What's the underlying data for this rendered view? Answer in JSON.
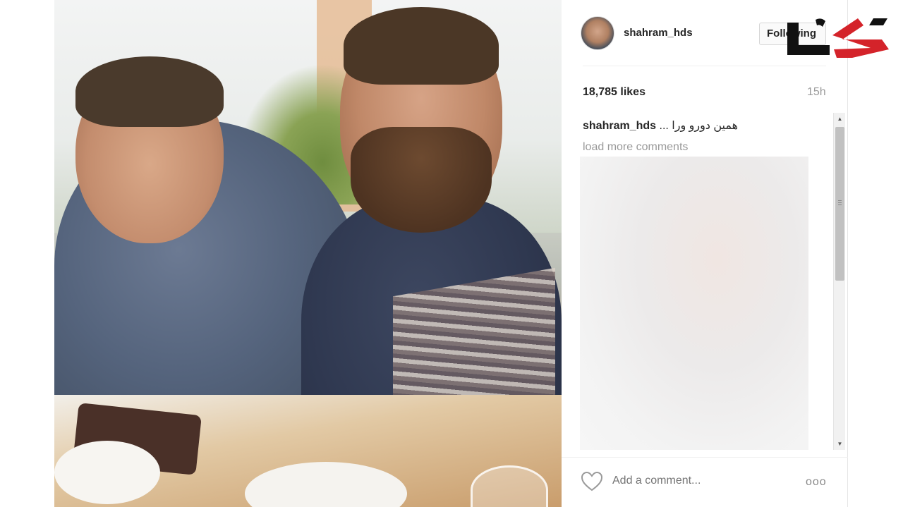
{
  "post": {
    "username": "shahram_hds",
    "follow_label": "Following",
    "likes": "18,785 likes",
    "time": "15h",
    "caption_user": "shahram_hds",
    "caption_text": "همین دورو ورا ...",
    "load_more": "load more comments",
    "add_comment_placeholder": "Add a comment...",
    "more_icon": "ooo"
  },
  "colors": {
    "logo_red": "#d4232a",
    "logo_black": "#111111"
  },
  "icons": [
    "heart-icon",
    "more-options-icon",
    "scroll-up-icon",
    "scroll-down-icon"
  ]
}
